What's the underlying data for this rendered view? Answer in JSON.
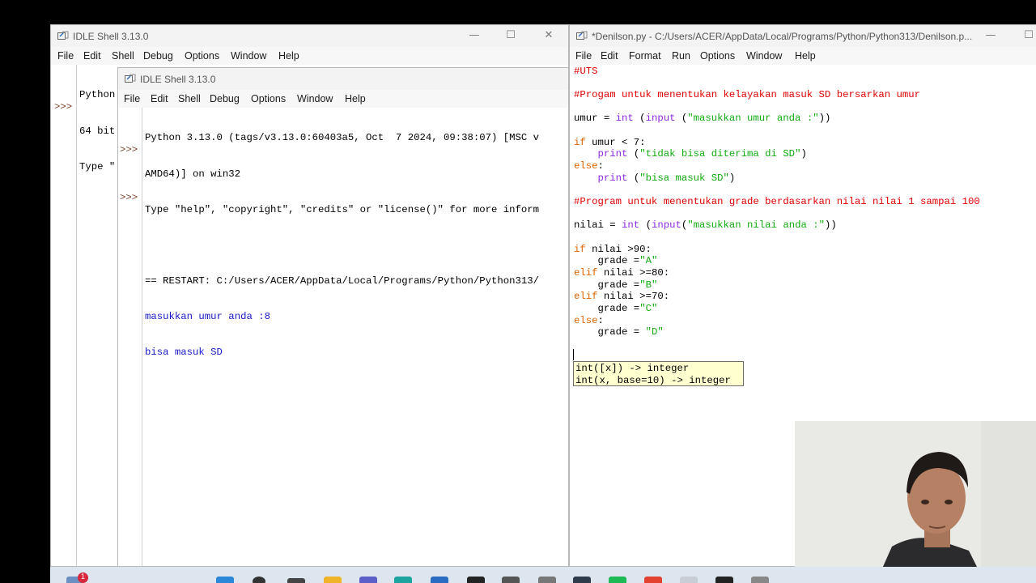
{
  "shell_back": {
    "title": "IDLE Shell 3.13.0",
    "menu": [
      "File",
      "Edit",
      "Shell",
      "Debug",
      "Options",
      "Window",
      "Help"
    ],
    "lines": [
      "Python",
      "64 bit",
      "Type \""
    ],
    "prompt": ">>>"
  },
  "shell_front": {
    "title": "IDLE Shell 3.13.0",
    "menu": [
      "File",
      "Edit",
      "Shell",
      "Debug",
      "Options",
      "Window",
      "Help"
    ],
    "banner_1": "Python 3.13.0 (tags/v3.13.0:60403a5, Oct  7 2024, 09:38:07) [MSC v",
    "banner_2": "AMD64)] on win32",
    "banner_3": "Type \"help\", \"copyright\", \"credits\" or \"license()\" for more inform",
    "restart": "== RESTART: C:/Users/ACER/AppData/Local/Programs/Python/Python313/",
    "input_prompt": "masukkan umur anda :8",
    "output": "bisa masuk SD",
    "prompt": ">>>"
  },
  "editor": {
    "title": "*Denilson.py - C:/Users/ACER/AppData/Local/Programs/Python/Python313/Denilson.p...",
    "menu": [
      "File",
      "Edit",
      "Format",
      "Run",
      "Options",
      "Window",
      "Help"
    ],
    "calltip": [
      "int([x]) -> integer",
      "int(x, base=10) -> integer"
    ]
  },
  "window_controls": {
    "minimize": "—",
    "maximize": "☐",
    "close": "✕"
  },
  "taskbar": {
    "notification_count": "1"
  }
}
